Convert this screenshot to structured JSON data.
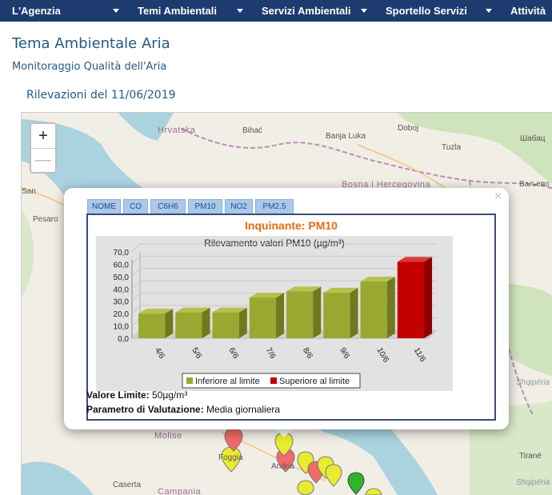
{
  "nav": {
    "items": [
      "L'Agenzia",
      "Temi Ambientali",
      "Servizi Ambientali",
      "Sportello Servizi",
      "Attività"
    ]
  },
  "page": {
    "title": "Tema Ambientale Aria",
    "subtitle": "Monitoraggio Qualità dell'Aria",
    "date_label": "Rilevazioni del 11/06/2019"
  },
  "map": {
    "zoom_in": "+",
    "zoom_out": "—",
    "places": [
      "Hrvatska",
      "Bihać",
      "Doboj",
      "Banja Luka",
      "Tuzla",
      "Шабац",
      "Bosna i Hercegovina",
      "Ваљево",
      "San",
      "Pesaro",
      "Molise",
      "Foggia",
      "Andria",
      "Caserta",
      "Campania",
      "Tiranë",
      "Shqipëria",
      "Shqipëria"
    ]
  },
  "popup": {
    "close": "×",
    "tabs": [
      "NOME",
      "CO",
      "C6H6",
      "PM10",
      "NO2",
      "PM2.5"
    ],
    "pollutant_label": "Inquinante: PM10",
    "limit_label": "Valore Limite:",
    "limit_value": " 50µg/m³",
    "param_label": "Parametro di Valutazione:",
    "param_value": " Media giornaliera"
  },
  "colors": {
    "nav_bg": "#1d3b6e",
    "title": "#245a86",
    "below_limit": "#9aa832",
    "above_limit": "#c40000",
    "pollutant_title": "#e86b10"
  },
  "chart_data": {
    "type": "bar",
    "title": "Rilevamento valori PM10 (µg/m³)",
    "categories": [
      "4/6",
      "5/6",
      "6/6",
      "7/6",
      "8/6",
      "9/6",
      "10/6",
      "11/6"
    ],
    "values": [
      20,
      21,
      21,
      33,
      38,
      37,
      46,
      62
    ],
    "status": [
      "below",
      "below",
      "below",
      "below",
      "below",
      "below",
      "below",
      "above"
    ],
    "yticks": [
      "0,0",
      "10,0",
      "20,0",
      "30,0",
      "40,0",
      "50,0",
      "60,0",
      "70,0"
    ],
    "ylim": [
      0,
      70
    ],
    "legend": [
      "Inferiore al limite",
      "Superiore al limite"
    ],
    "legend_position": "bottom"
  }
}
